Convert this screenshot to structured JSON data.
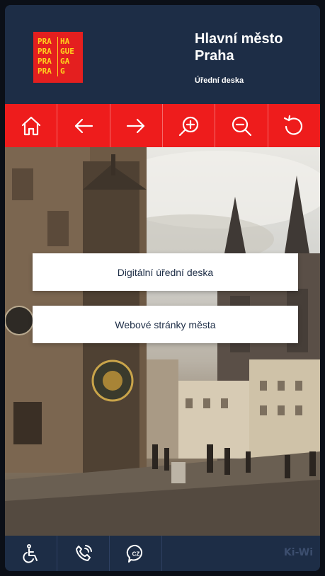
{
  "header": {
    "logo_rows": [
      [
        "PRA",
        "HA"
      ],
      [
        "PRA",
        "GUE"
      ],
      [
        "PRA",
        "GA"
      ],
      [
        "PRA",
        "G"
      ]
    ],
    "title_line1": "Hlavní město",
    "title_line2": "Praha",
    "subtitle": "Úřední deska"
  },
  "toolbar": {
    "buttons": [
      {
        "icon": "home-icon"
      },
      {
        "icon": "arrow-left-icon"
      },
      {
        "icon": "arrow-right-icon"
      },
      {
        "icon": "zoom-in-icon"
      },
      {
        "icon": "zoom-out-icon"
      },
      {
        "icon": "reload-icon"
      }
    ]
  },
  "main": {
    "btn_desk": "Digitální úřední deska",
    "btn_web": "Webové stránky města"
  },
  "footer": {
    "buttons": [
      {
        "icon": "wheelchair-icon"
      },
      {
        "icon": "phone-call-icon"
      },
      {
        "icon": "language-cz-icon",
        "label": "CZ"
      }
    ],
    "brand": "Ki-Wi"
  },
  "colors": {
    "navy": "#1d2d46",
    "red": "#ee1c1c",
    "logo_red": "#e41f1f",
    "logo_yellow": "#ffd21f",
    "white": "#ffffff"
  }
}
